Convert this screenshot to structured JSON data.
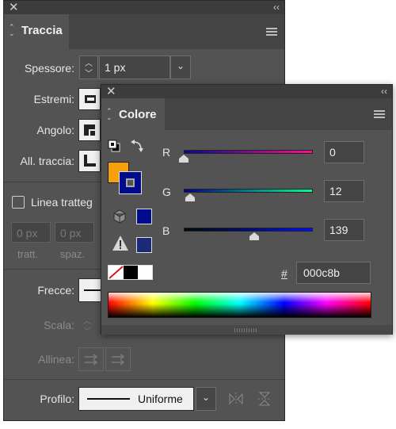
{
  "stroke_panel": {
    "title": "Traccia",
    "labels": {
      "weight": "Spessore:",
      "caps": "Estremi:",
      "corner": "Angolo:",
      "align": "All. traccia:",
      "dashed": "Linea tratteg",
      "arrowheads": "Frecce:",
      "scale": "Scala:",
      "align_arrows": "Allinea:",
      "profile": "Profilo:"
    },
    "weight_value": "1 px",
    "dash_fields": [
      {
        "value": "0 px",
        "caption": "tratt."
      },
      {
        "value": "0 px",
        "caption": "spaz."
      }
    ],
    "profile_value": "Uniforme"
  },
  "color_panel": {
    "title": "Colore",
    "channels": [
      {
        "label": "R",
        "value": "0",
        "fraction": 0.0
      },
      {
        "label": "G",
        "value": "12",
        "fraction": 0.047
      },
      {
        "label": "B",
        "value": "139",
        "fraction": 0.545
      }
    ],
    "hex_label": "#",
    "hex_value": "000c8b",
    "colors": {
      "fill": "#f5a00c",
      "stroke": "#000c8b",
      "r_track": "#ff0080",
      "g_track": "#00e070",
      "b_track": "#0000ff"
    }
  }
}
